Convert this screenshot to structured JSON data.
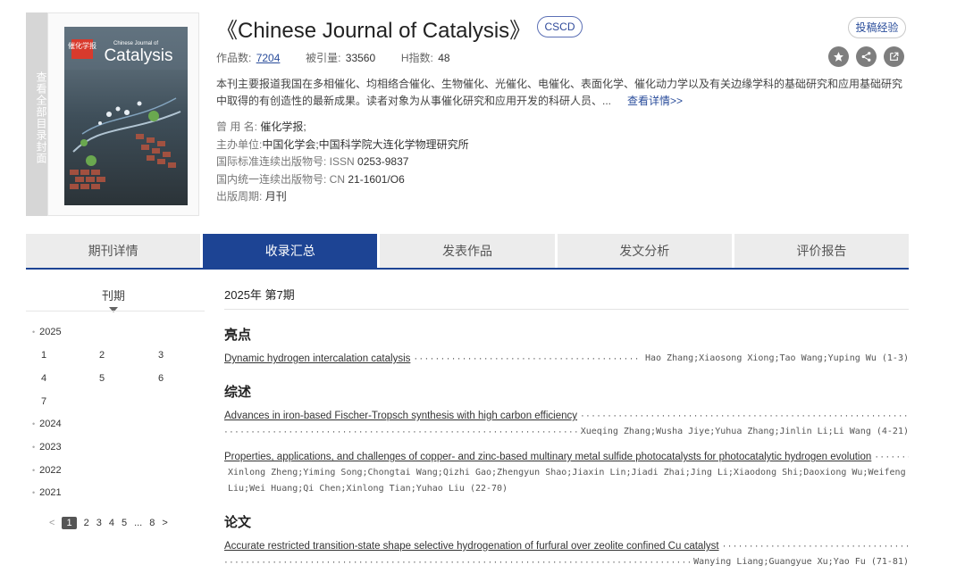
{
  "cover": {
    "side_label": "查看全部目录封面",
    "journal_cn": "催化学报",
    "journal_en_top": "Chinese Journal of",
    "journal_en_main": "Catalysis"
  },
  "journal": {
    "title": "《Chinese Journal of Catalysis》",
    "badge": "CSCD",
    "submit_label": "投稿经验",
    "stats": {
      "works_label": "作品数:",
      "works_value": "7204",
      "cited_label": "被引量:",
      "cited_value": "33560",
      "h_label": "H指数:",
      "h_value": "48"
    },
    "description": "本刊主要报道我国在多相催化、均相络合催化、生物催化、光催化、电催化、表面化学、催化动力学以及有关边缘学科的基础研究和应用基础研究中取得的有创造性的最新成果。读者对象为从事催化研究和应用开发的科研人员、...",
    "more_label": "查看详情>>",
    "meta": [
      {
        "label": "曾 用 名:",
        "value": "催化学报;"
      },
      {
        "label": "主办单位:",
        "value": "中国化学会;中国科学院大连化学物理研究所"
      },
      {
        "label": "国际标准连续出版物号: ISSN",
        "value": "0253-9837"
      },
      {
        "label": "国内统一连续出版物号: CN",
        "value": "21-1601/O6"
      },
      {
        "label": "出版周期:",
        "value": "月刊"
      }
    ]
  },
  "tabs": [
    "期刊详情",
    "收录汇总",
    "发表作品",
    "发文分析",
    "评价报告"
  ],
  "active_tab": 1,
  "sidebar": {
    "heading": "刊期",
    "years": [
      "2025",
      "2024",
      "2023",
      "2022",
      "2021"
    ],
    "issues_2025": [
      "1",
      "2",
      "3",
      "4",
      "5",
      "6",
      "7"
    ],
    "pager": {
      "prev": "<",
      "pages": [
        "1",
        "2",
        "3",
        "4",
        "5",
        "...",
        "8"
      ],
      "next": ">"
    }
  },
  "main": {
    "issue_title": "2025年 第7期",
    "sections": [
      {
        "name": "亮点",
        "articles": [
          {
            "title": "Dynamic hydrogen intercalation catalysis",
            "authors": "Hao Zhang;Xiaosong Xiong;Tao Wang;Yuping Wu",
            "pages": "(1-3)"
          }
        ]
      },
      {
        "name": "综述",
        "articles": [
          {
            "title": "Advances in iron-based Fischer-Tropsch synthesis with high carbon efficiency",
            "authors": "Xueqing Zhang;Wusha Jiye;Yuhua Zhang;Jinlin Li;Li Wang",
            "pages": "(4-21)"
          },
          {
            "title": "Properties, applications, and challenges of copper- and zinc-based multinary metal sulfide photocatalysts for photocatalytic hydrogen evolution",
            "authors": "Xinlong Zheng;Yiming Song;Chongtai Wang;Qizhi Gao;Zhengyun Shao;Jiaxin Lin;Jiadi Zhai;Jing Li;Xiaodong Shi;Daoxiong Wu;Weifeng Liu;Wei Huang;Qi Chen;Xinlong Tian;Yuhao Liu",
            "pages": "(22-70)"
          }
        ]
      },
      {
        "name": "论文",
        "articles": [
          {
            "title": "Accurate restricted transition-state shape selective hydrogenation of furfural over zeolite confined Cu catalyst",
            "authors": "Wanying Liang;Guangyue Xu;Yao Fu",
            "pages": "(71-81)"
          }
        ]
      }
    ]
  }
}
